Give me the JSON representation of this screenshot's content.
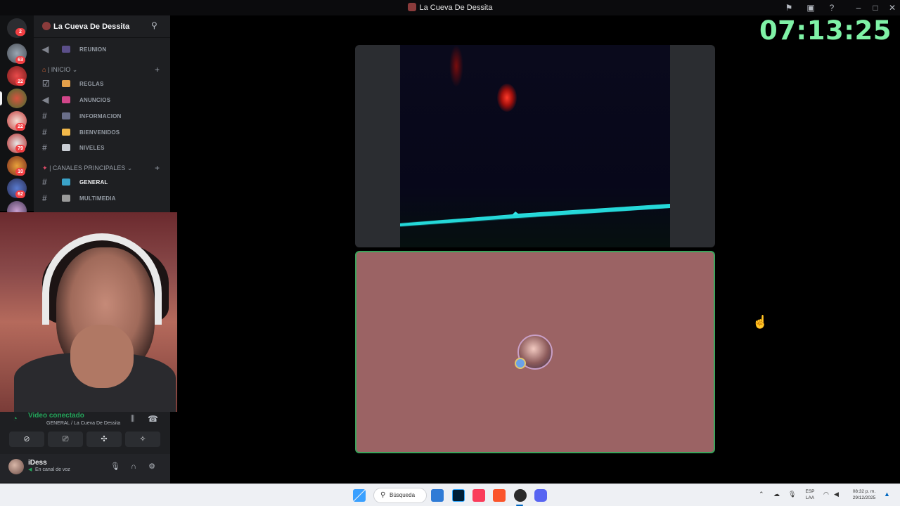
{
  "window": {
    "title": "La Cueva De Dessita"
  },
  "timer": "07:13:25",
  "server": {
    "name": "La Cueva De Dessita"
  },
  "rail": {
    "badges": [
      "63",
      "22",
      "22",
      "79",
      "10",
      "62"
    ],
    "top_badge": "2"
  },
  "channels": {
    "reunion": "REUNION",
    "cat_inicio": "| INICIO",
    "reglas": "REGLAS",
    "anuncios": "ANUNCIOS",
    "informacion": "INFORMACION",
    "bienvenidos": "BIENVENIDOS",
    "niveles": "NIVELES",
    "cat_principales": "| CANALES PRINCIPALES",
    "general": "GENERAL",
    "multimedia": "MULTIMEDIA"
  },
  "voice": {
    "status": "Video conectado",
    "location": "GENERAL / La Cueva De Dessita"
  },
  "user": {
    "name": "iDess",
    "status": "En canal de voz"
  },
  "taskbar": {
    "search_label": "Búsqueda",
    "lang_line1": "ESP",
    "lang_line2": "LAA",
    "time": "08:32 p. m.",
    "date": "29/12/2025"
  },
  "colors": {
    "accent_green": "#7ff2a6",
    "voice_connected": "#23a55a",
    "speaking_border": "#3ba55c",
    "tile_bg": "#9b6364"
  }
}
